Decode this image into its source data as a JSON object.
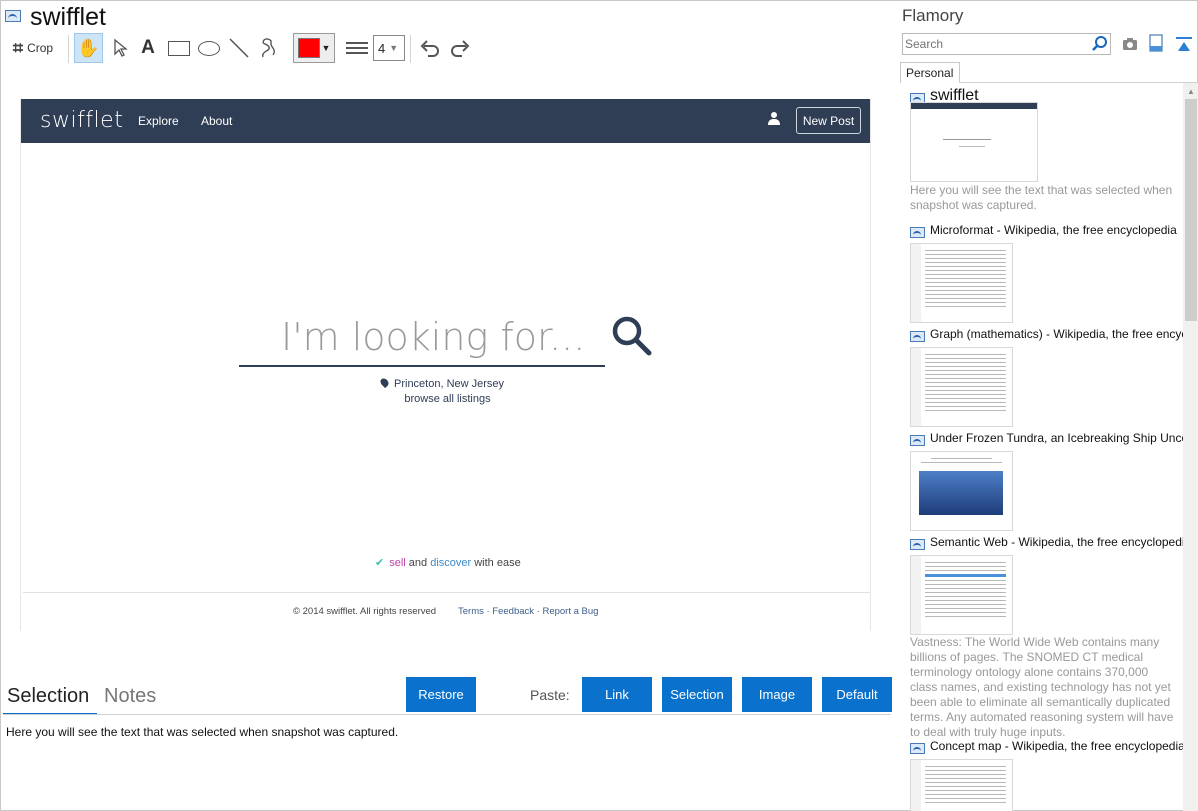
{
  "window": {
    "title": "swifflet"
  },
  "toolbar": {
    "crop_label": "Crop",
    "tools": [
      "hand-icon",
      "arrow-icon",
      "text-icon",
      "rectangle-icon",
      "ellipse-icon",
      "line-icon",
      "freehand-icon"
    ],
    "color": "#ff0000",
    "line_width": "4"
  },
  "snapshot": {
    "logo": "swifflet",
    "nav": {
      "explore": "Explore",
      "about": "About",
      "new_post": "New Post"
    },
    "search_placeholder": "I'm looking for...",
    "location": "Princeton, New Jersey",
    "browse_all": "browse all listings",
    "tagline": {
      "sell": "sell",
      "and": " and ",
      "discover": "discover",
      "rest": " with ease"
    },
    "copyright": "© 2014 swifflet. All rights reserved",
    "footer_links": "Terms · Feedback · Report a Bug"
  },
  "bottom_panel": {
    "tabs": [
      "Selection",
      "Notes"
    ],
    "restore": "Restore",
    "paste_label": "Paste:",
    "paste_buttons": [
      "Link",
      "Selection",
      "Image",
      "Default"
    ],
    "selection_text": "Here you will see the text that was selected when snapshot was captured."
  },
  "flamory": {
    "title": "Flamory",
    "search_placeholder": "Search",
    "tab": "Personal",
    "items": [
      {
        "title": "swifflet",
        "note": "Here you will see the text that was selected when snapshot was captured."
      },
      {
        "title": "Microformat - Wikipedia, the free encyclopedia"
      },
      {
        "title": "Graph (mathematics) - Wikipedia, the free encyclopedia"
      },
      {
        "title": "Under Frozen Tundra, an Icebreaking Ship Uncovers"
      },
      {
        "title": "Semantic Web - Wikipedia, the free encyclopedia",
        "note": "Vastness: The World Wide Web contains many billions of pages. The SNOMED CT medical terminology ontology alone contains 370,000 class names, and existing technology has not yet been able to eliminate all semantically duplicated terms. Any automated reasoning system will have to deal with truly huge inputs."
      },
      {
        "title": "Concept map - Wikipedia, the free encyclopedia"
      }
    ]
  }
}
